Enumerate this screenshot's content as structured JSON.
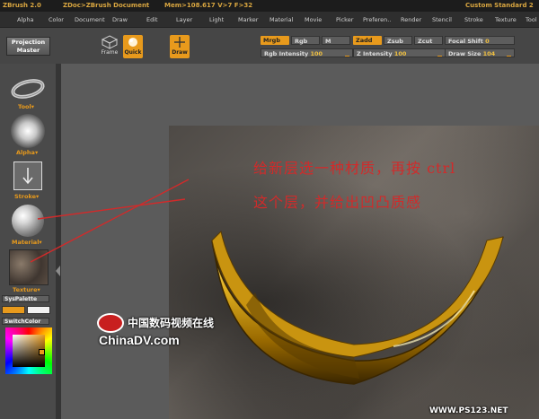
{
  "titlebar": {
    "app": "ZBrush 2.0",
    "doc": "ZDoc>ZBrush Document",
    "mem": "Mem>108.617  V>7  F>32",
    "right": "Custom Standard 2"
  },
  "menu": [
    "Alpha",
    "Color",
    "Document",
    "Draw",
    "Edit",
    "Layer",
    "Light",
    "Marker",
    "Material",
    "Movie",
    "Picker",
    "Preferen..",
    "Render",
    "Stencil",
    "Stroke",
    "Texture",
    "Tool"
  ],
  "toolbar": {
    "projection_master": [
      "Projection",
      "Master"
    ],
    "frame_label": "Frame",
    "quick_label": "Quick",
    "draw_label": "Draw",
    "mrgb": "Mrgb",
    "rgb": "Rgb",
    "m": "M",
    "zadd": "Zadd",
    "zsub": "Zsub",
    "zcut": "Zcut",
    "focal_shift_label": "Focal Shift",
    "focal_shift_value": "0",
    "rgb_intensity_label": "Rgb Intensity",
    "rgb_intensity_value": "100",
    "z_intensity_label": "Z Intensity",
    "z_intensity_value": "100",
    "draw_size_label": "Draw Size",
    "draw_size_value": "104"
  },
  "left_panel": {
    "tool": "Tool",
    "alpha": "Alpha",
    "stroke": "Stroke",
    "material": "Material",
    "texture": "Texture",
    "syspalette": "SysPalette",
    "switchcolor": "SwitchColor"
  },
  "annotation": {
    "line1": "给新层选一种材质，再按 ctrl",
    "line2": "这个层，并给出凹凸质感"
  },
  "watermark": {
    "cn": "中国数码视频在线",
    "latin": "ChinaDV.com",
    "corner": "WWW.PS123.NET"
  },
  "colors": {
    "accent": "#e89a1c",
    "annotation": "#d22a2a"
  }
}
